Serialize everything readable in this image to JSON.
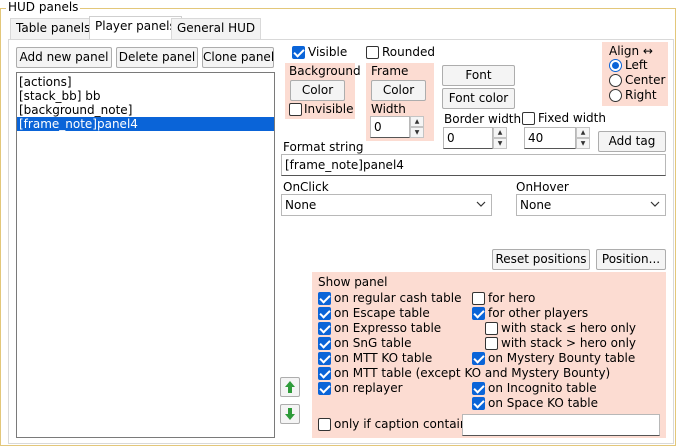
{
  "window": {
    "title": "HUD panels"
  },
  "tabs": [
    {
      "label": "Table panels"
    },
    {
      "label": "Player panels"
    },
    {
      "label": "General HUD"
    }
  ],
  "toolbar": {
    "add_label": "Add new panel",
    "delete_label": "Delete panel",
    "clone_label": "Clone panel"
  },
  "panel_list": [
    {
      "label": "[actions]"
    },
    {
      "label": "[stack_bb] bb"
    },
    {
      "label": "[background_note]"
    },
    {
      "label": "[frame_note]panel4"
    }
  ],
  "visible_label": "Visible",
  "rounded_label": "Rounded",
  "background": {
    "title": "Background",
    "color_btn": "Color",
    "invisible_label": "Invisible"
  },
  "frame": {
    "title": "Frame",
    "color_btn": "Color",
    "width_label": "Width",
    "width_value": "0"
  },
  "font_btn": "Font",
  "font_color_btn": "Font color",
  "border_width": {
    "label": "Border width",
    "value": "0"
  },
  "fixed_width": {
    "label": "Fixed width",
    "value": "40"
  },
  "add_tag_btn": "Add tag",
  "align": {
    "title": "Align ↔",
    "options": [
      "Left",
      "Center",
      "Right"
    ]
  },
  "format_string": {
    "label": "Format string",
    "value": "[frame_note]panel4"
  },
  "onclick": {
    "label": "OnClick",
    "value": "None"
  },
  "onhover": {
    "label": "OnHover",
    "value": "None"
  },
  "reset_positions_btn": "Reset positions",
  "position_btn": "Position...",
  "show_panel": {
    "title": "Show panel",
    "left": [
      "on regular cash table",
      "on Escape table",
      "on Expresso table",
      "on SnG table",
      "on MTT KO table",
      "on MTT table (except KO and Mystery Bounty)",
      "on replayer"
    ],
    "right": [
      "for hero",
      "for other players",
      "with stack ≤ hero only",
      "with stack > hero only",
      "on Mystery Bounty table",
      "on Incognito table",
      "on Space KO table"
    ],
    "caption_label": "only if caption contains",
    "caption_value": ""
  },
  "colors": {
    "accent": "#0a64d8",
    "section_bg": "#fcdcd2",
    "group_border": "#e3c77a"
  }
}
